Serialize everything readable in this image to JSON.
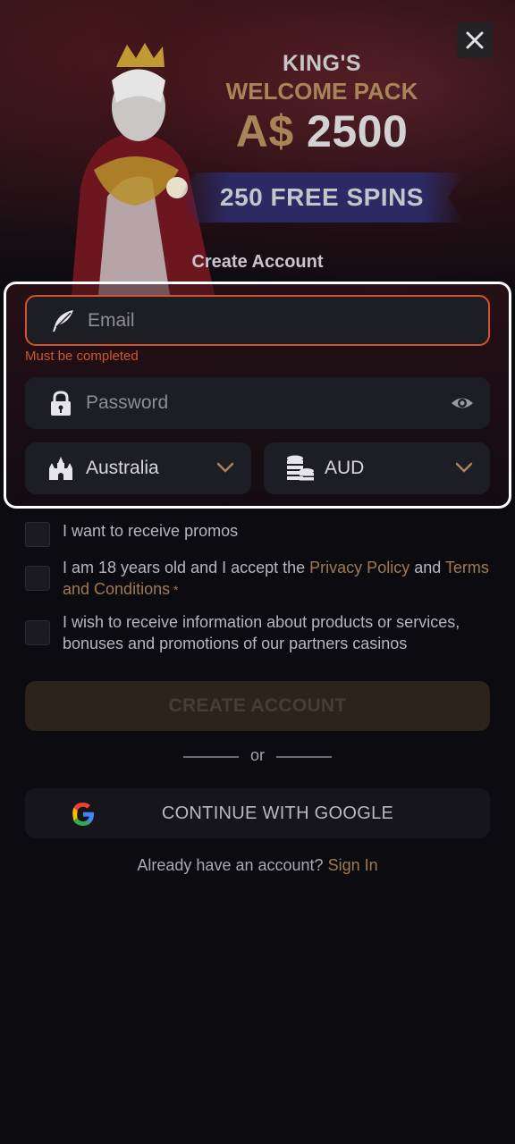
{
  "promo": {
    "line1": "KING'S",
    "line2": "WELCOME PACK",
    "currency": "A$",
    "amount": "2500",
    "spins": "250 FREE SPINS"
  },
  "form": {
    "title": "Create Account",
    "email_placeholder": "Email",
    "email_error": "Must be completed",
    "password_placeholder": "Password",
    "country": "Australia",
    "currency": "AUD"
  },
  "checks": {
    "promos": "I want to receive promos",
    "age_prefix": "I am 18 years old and I accept the ",
    "privacy": "Privacy Policy",
    "and": " and ",
    "terms": "Terms and Conditions",
    "required": " *",
    "partners": "I wish to receive information about products or services, bonuses and promotions of our partners casinos"
  },
  "actions": {
    "create": "CREATE ACCOUNT",
    "or": "or",
    "google": "CONTINUE WITH GOOGLE",
    "have_account": "Already have an account?",
    "sign_in": "Sign In"
  },
  "colors": {
    "accent": "#a88459",
    "error": "#d2542c",
    "field_bg": "#1d1d24",
    "background": "#0b0b10"
  }
}
